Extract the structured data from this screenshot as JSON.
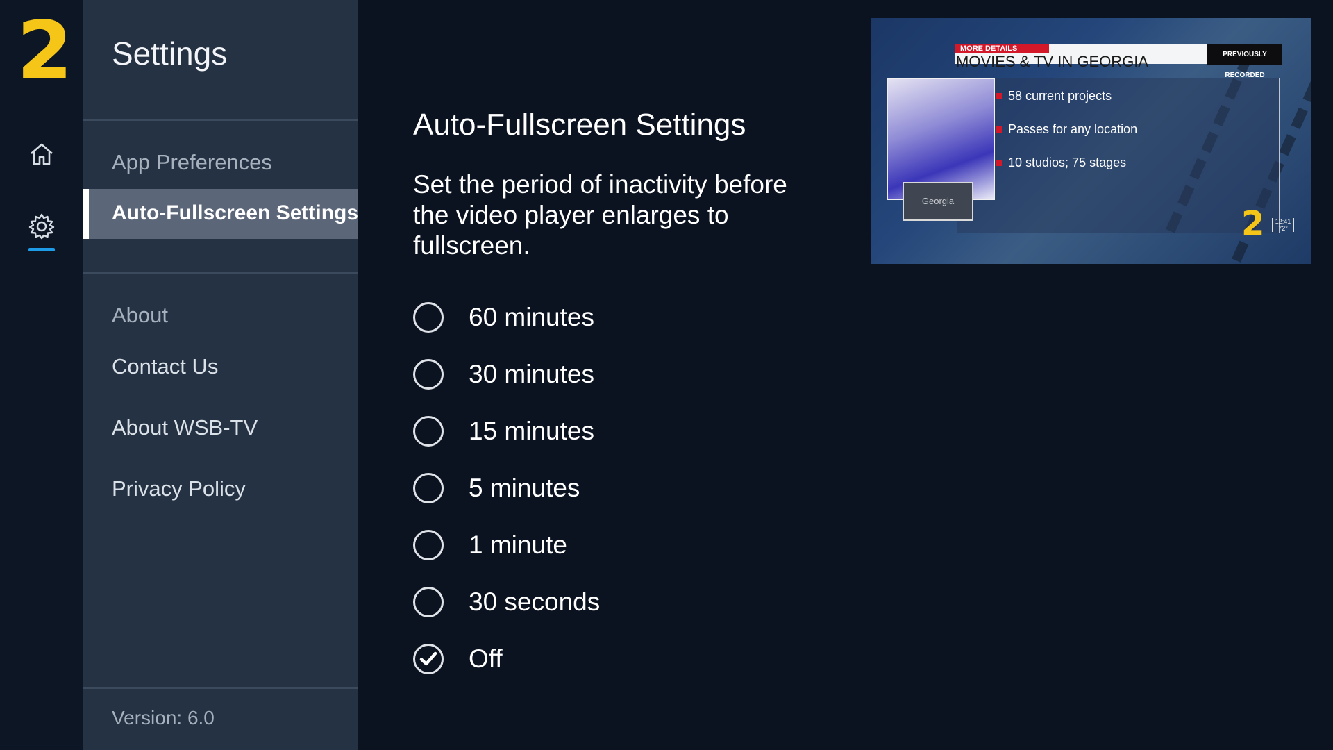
{
  "rail": {
    "logo": "2",
    "items": [
      {
        "name": "home",
        "icon": "home-icon",
        "active": false
      },
      {
        "name": "settings",
        "icon": "gear-icon",
        "active": true
      }
    ],
    "active_color": "#1e9be6"
  },
  "settings_panel": {
    "title": "Settings",
    "nav": [
      {
        "label": "App Preferences",
        "selected": false
      },
      {
        "label": "Auto-Fullscreen Settings",
        "selected": true
      },
      {
        "label": "About",
        "selected": false
      },
      {
        "label": "Contact Us",
        "selected": false
      },
      {
        "label": "About WSB-TV",
        "selected": false
      },
      {
        "label": "Privacy Policy",
        "selected": false
      }
    ],
    "version": "Version: 6.0"
  },
  "main": {
    "title": "Auto-Fullscreen Settings",
    "description": "Set the period of inactivity before the video player enlarges to fullscreen.",
    "options": [
      {
        "label": "60 minutes",
        "checked": false
      },
      {
        "label": "30 minutes",
        "checked": false
      },
      {
        "label": "15 minutes",
        "checked": false
      },
      {
        "label": "5 minutes",
        "checked": false
      },
      {
        "label": "1 minute",
        "checked": false
      },
      {
        "label": "30 seconds",
        "checked": false
      },
      {
        "label": "Off",
        "checked": true
      }
    ]
  },
  "video_preview": {
    "tag": "MORE DETAILS",
    "headline": "MOVIES & TV IN GEORGIA",
    "badge": "PREVIOUSLY RECORDED",
    "bullets": [
      "58 current projects",
      "Passes for any location",
      "10 studios; 75 stages"
    ],
    "thumb_label": "Georgia",
    "watermark": "2",
    "time": "12:41",
    "temp": "72°"
  }
}
